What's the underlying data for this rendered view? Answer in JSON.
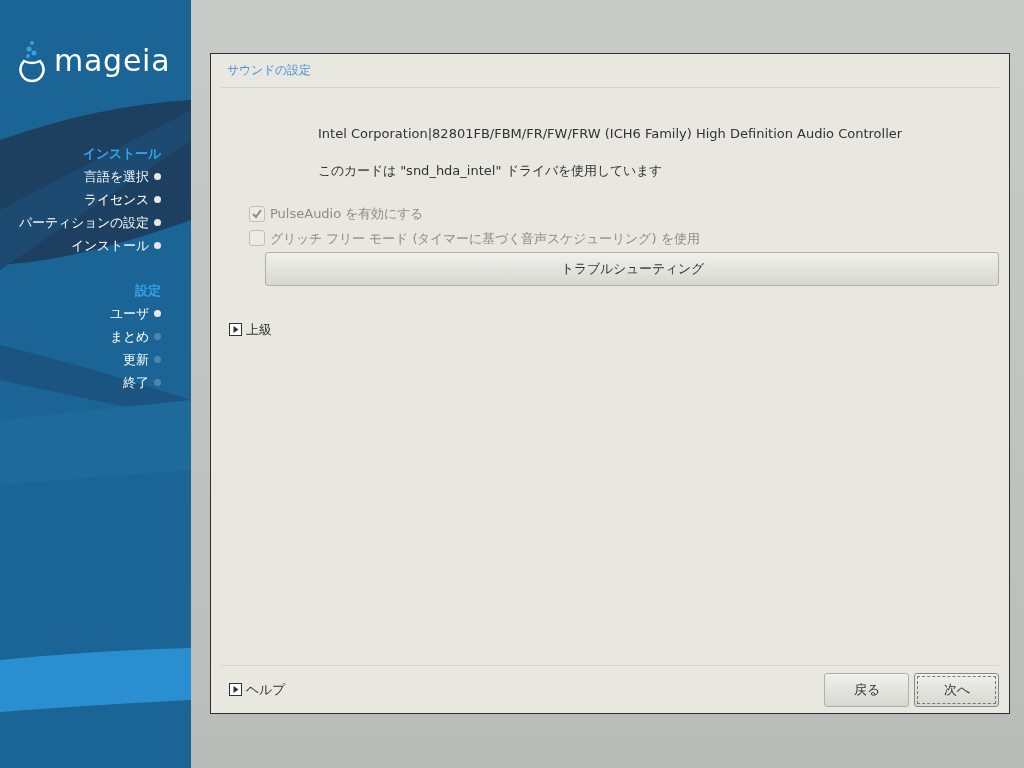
{
  "logo": {
    "text": "mageia"
  },
  "sidebar": {
    "sections": [
      {
        "title": "インストール",
        "items": [
          {
            "label": "言語を選択",
            "done": true
          },
          {
            "label": "ライセンス",
            "done": true
          },
          {
            "label": "パーティションの設定",
            "done": true
          },
          {
            "label": "インストール",
            "done": true
          }
        ]
      },
      {
        "title": "設定",
        "items": [
          {
            "label": "ユーザ",
            "done": true
          },
          {
            "label": "まとめ",
            "done": false
          },
          {
            "label": "更新",
            "done": false
          },
          {
            "label": "終了",
            "done": false
          }
        ]
      }
    ]
  },
  "dialog": {
    "title": "サウンドの設定",
    "card_name": "Intel Corporation|82801FB/FBM/FR/FW/FRW (ICH6 Family) High Definition Audio Controller",
    "driver_text": "このカードは \"snd_hda_intel\" ドライバを使用しています",
    "options": [
      {
        "label": "PulseAudio を有効にする",
        "checked": true,
        "disabled": true
      },
      {
        "label": "グリッチ フリー モード (タイマーに基づく音声スケジューリング) を使用",
        "checked": false,
        "disabled": true
      }
    ],
    "troubleshoot_button": "トラブルシューティング",
    "advanced": {
      "label": "上級",
      "expanded": false
    },
    "help": {
      "label": "ヘルプ",
      "expanded": false
    },
    "buttons": [
      {
        "label": "戻る",
        "focused": false
      },
      {
        "label": "次へ",
        "focused": true
      }
    ]
  }
}
